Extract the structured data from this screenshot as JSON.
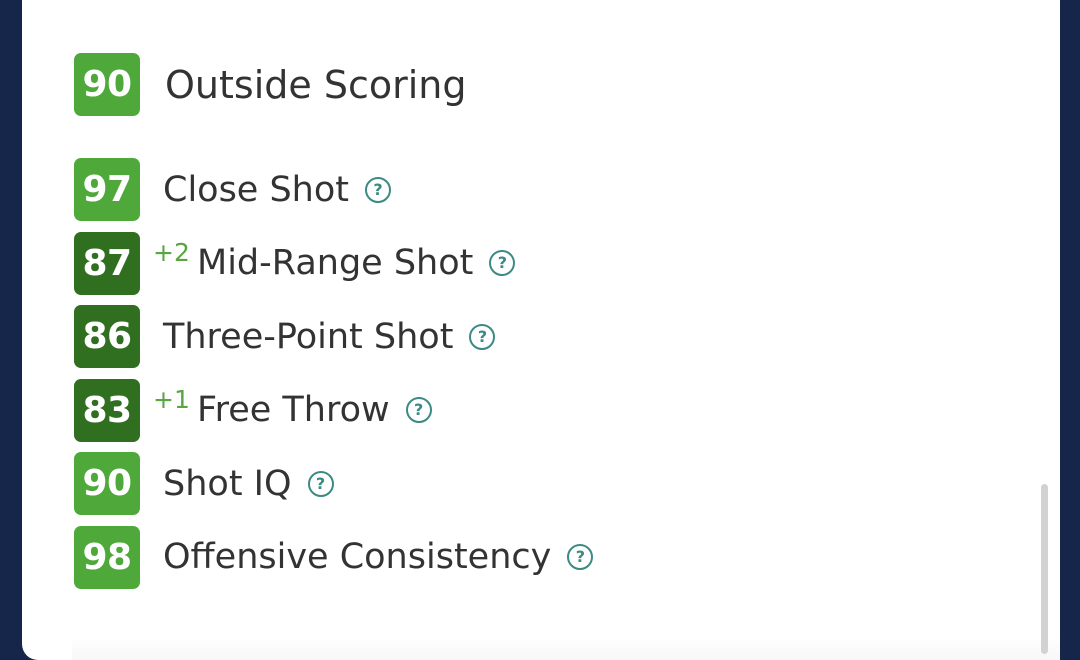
{
  "section": {
    "rating": "90",
    "title": "Outside Scoring"
  },
  "attributes": [
    {
      "rating": "97",
      "boost": "",
      "label": "Close Shot",
      "shade": "light"
    },
    {
      "rating": "87",
      "boost": "+2",
      "label": "Mid-Range Shot",
      "shade": "dark"
    },
    {
      "rating": "86",
      "boost": "",
      "label": "Three-Point Shot",
      "shade": "dark"
    },
    {
      "rating": "83",
      "boost": "+1",
      "label": "Free Throw",
      "shade": "dark"
    },
    {
      "rating": "90",
      "boost": "",
      "label": "Shot IQ",
      "shade": "light"
    },
    {
      "rating": "98",
      "boost": "",
      "label": "Offensive Consistency",
      "shade": "light"
    }
  ],
  "icons": {
    "help": "question-circle-icon",
    "help_glyph": "?"
  },
  "colors": {
    "badge_light": "#4ea93a",
    "badge_dark": "#2f6f1f",
    "boost": "#5aa543",
    "help_icon": "#3c8a84",
    "background": "#15264a"
  }
}
